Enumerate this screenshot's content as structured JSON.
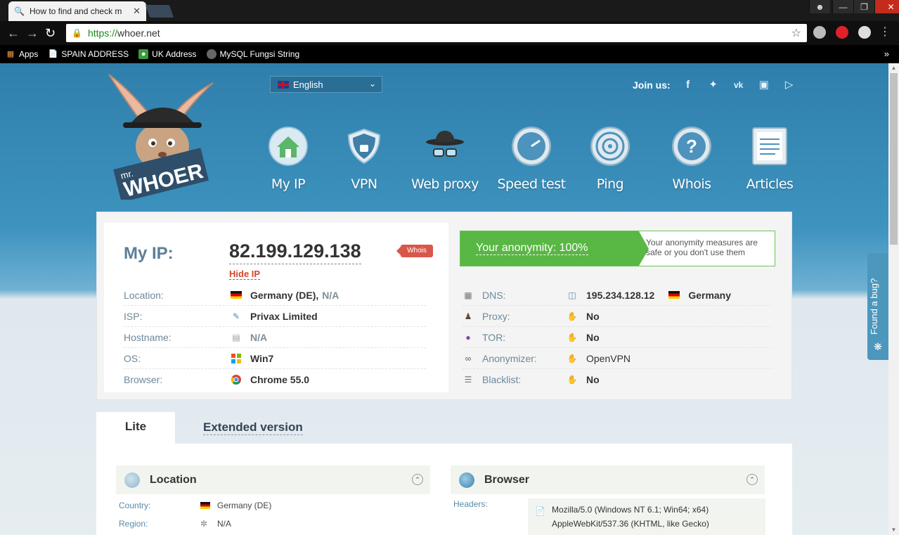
{
  "browser": {
    "tab_title": "How to find and check m",
    "url_scheme": "https://",
    "url_host": "whoer.net",
    "bookmarks": [
      {
        "label": "Apps",
        "icon": "apps-grid-icon"
      },
      {
        "label": "SPAIN ADDRESS",
        "icon": "page-icon"
      },
      {
        "label": "UK Address",
        "icon": "maps-pin-icon"
      },
      {
        "label": "MySQL Fungsi String",
        "icon": "site-icon"
      }
    ],
    "more_bookmarks": "»"
  },
  "header": {
    "logo_mr": "mr.",
    "logo_name": "WHOER",
    "language": "English",
    "join_us": "Join us:",
    "social_icons": [
      "facebook-icon",
      "twitter-icon",
      "vk-icon",
      "instagram-icon",
      "youtube-icon"
    ],
    "nav": [
      {
        "label": "My IP",
        "icon": "home-icon"
      },
      {
        "label": "VPN",
        "icon": "shield-icon"
      },
      {
        "label": "Web proxy",
        "icon": "spy-hat-icon"
      },
      {
        "label": "Speed test",
        "icon": "speedometer-icon"
      },
      {
        "label": "Ping",
        "icon": "ping-icon"
      },
      {
        "label": "Whois",
        "icon": "question-icon"
      },
      {
        "label": "Articles",
        "icon": "article-icon"
      }
    ]
  },
  "ipinfo": {
    "label": "My IP:",
    "ip": "82.199.129.138",
    "hide_ip": "Hide IP",
    "whois": "Whois",
    "rows": [
      {
        "label": "Location:",
        "value": "Germany (DE),",
        "extra": "N/A"
      },
      {
        "label": "ISP:",
        "value": "Privax Limited"
      },
      {
        "label": "Hostname:",
        "value": "N/A"
      },
      {
        "label": "OS:",
        "value": "Win7"
      },
      {
        "label": "Browser:",
        "value": "Chrome 55.0"
      }
    ]
  },
  "anonymity": {
    "headline": "Your anonymity: 100%",
    "note": "Your anonymity measures are safe or you don't use them",
    "rows": [
      {
        "label": "DNS:",
        "value": "195.234.128.12",
        "extra": "Germany"
      },
      {
        "label": "Proxy:",
        "value": "No"
      },
      {
        "label": "TOR:",
        "value": "No"
      },
      {
        "label": "Anonymizer:",
        "value": "OpenVPN"
      },
      {
        "label": "Blacklist:",
        "value": "No"
      }
    ]
  },
  "tabs": {
    "lite": "Lite",
    "extended": "Extended version"
  },
  "location": {
    "title": "Location",
    "rows": [
      {
        "label": "Country:",
        "value": "Germany (DE)"
      },
      {
        "label": "Region:",
        "value": "N/A"
      }
    ]
  },
  "browser_section": {
    "title": "Browser",
    "headers_label": "Headers:",
    "headers_lines": [
      "Mozilla/5.0 (Windows NT 6.1; Win64; x64)",
      "AppleWebKit/537.36 (KHTML, like Gecko)"
    ]
  },
  "bug_report": "Found a bug?"
}
